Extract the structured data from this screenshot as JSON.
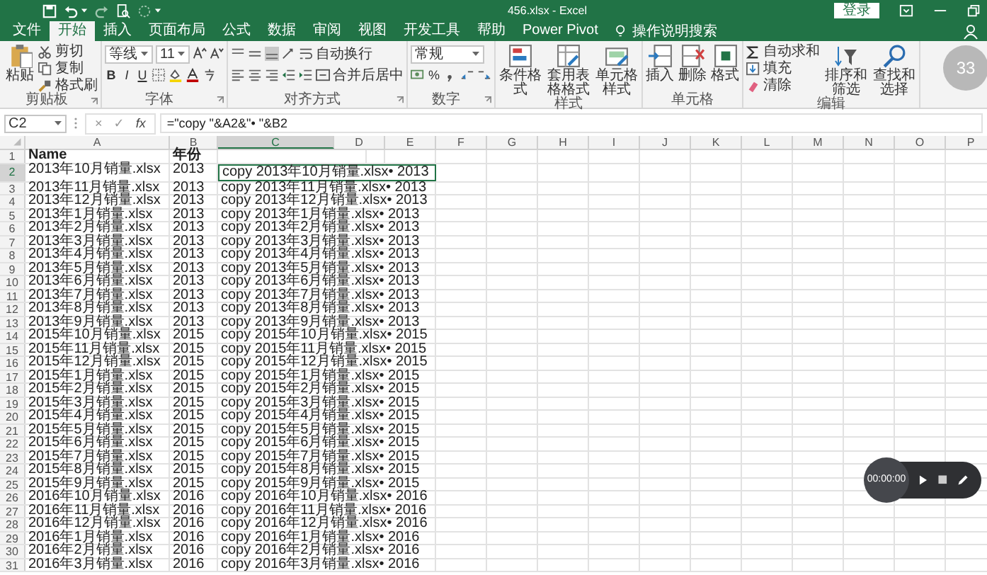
{
  "title_bar": {
    "title": "456.xlsx  -  Excel",
    "sign_in": "登录"
  },
  "tabs": [
    {
      "label": "文件",
      "selected": false
    },
    {
      "label": "开始",
      "selected": true
    },
    {
      "label": "插入",
      "selected": false
    },
    {
      "label": "页面布局",
      "selected": false
    },
    {
      "label": "公式",
      "selected": false
    },
    {
      "label": "数据",
      "selected": false
    },
    {
      "label": "审阅",
      "selected": false
    },
    {
      "label": "视图",
      "selected": false
    },
    {
      "label": "开发工具",
      "selected": false
    },
    {
      "label": "帮助",
      "selected": false
    },
    {
      "label": "Power Pivot",
      "selected": false
    }
  ],
  "tell_me": "操作说明搜索",
  "ribbon_groups": [
    {
      "kind": "clipboard",
      "label": "剪贴板",
      "buttons": [
        "粘贴",
        "剪切",
        "复制",
        "格式刷"
      ]
    },
    {
      "kind": "font",
      "label": "字体",
      "font_name": "等线",
      "font_size": "11",
      "style_buttons": [
        "B",
        "I",
        "U"
      ]
    },
    {
      "kind": "alignment",
      "label": "对齐方式",
      "buttons": [
        "自动换行",
        "合并后居中"
      ]
    },
    {
      "kind": "number",
      "label": "数字",
      "format": "常规",
      "percent": "%"
    },
    {
      "kind": "large_buttons",
      "label": "样式",
      "buttons": [
        "条件格式",
        "套用表格格式",
        "单元格样式"
      ]
    },
    {
      "kind": "large_buttons",
      "label": "单元格",
      "buttons": [
        "插入",
        "删除",
        "格式"
      ]
    },
    {
      "kind": "editing",
      "label": "编辑",
      "small_buttons": [
        "自动求和",
        "填充",
        "清除"
      ],
      "large_buttons": [
        "排序和筛选",
        "查找和选择"
      ]
    }
  ],
  "progress_badge": "33",
  "formula_bar": {
    "name_box": "C2",
    "cancel": "×",
    "enter": "✓",
    "function": "fx",
    "formula": "=\"copy \"&A2&\"• \"&B2"
  },
  "columns": [
    {
      "label": "A",
      "selected": false
    },
    {
      "label": "B",
      "selected": false
    },
    {
      "label": "C",
      "selected": true
    },
    {
      "label": "D",
      "selected": false
    },
    {
      "label": "E",
      "selected": false
    },
    {
      "label": "F",
      "selected": false
    },
    {
      "label": "G",
      "selected": false
    },
    {
      "label": "H",
      "selected": false
    },
    {
      "label": "I",
      "selected": false
    },
    {
      "label": "J",
      "selected": false
    },
    {
      "label": "K",
      "selected": false
    },
    {
      "label": "L",
      "selected": false
    },
    {
      "label": "M",
      "selected": false
    },
    {
      "label": "N",
      "selected": false
    },
    {
      "label": "O",
      "selected": false
    },
    {
      "label": "P",
      "selected": false
    }
  ],
  "rows": [
    {
      "num": "1",
      "kind": "header",
      "a": "Name",
      "b": "年份",
      "selected": false
    },
    {
      "num": "2",
      "kind": "data",
      "a": "2013年10月销量.xlsx",
      "b": "2013",
      "c": "copy 2013年10月销量.xlsx• 2013",
      "selected": true
    },
    {
      "num": "3",
      "kind": "data",
      "a": "2013年11月销量.xlsx",
      "b": "2013",
      "c": "copy 2013年11月销量.xlsx• 2013",
      "selected": false
    },
    {
      "num": "4",
      "kind": "data",
      "a": "2013年12月销量.xlsx",
      "b": "2013",
      "c": "copy 2013年12月销量.xlsx• 2013",
      "selected": false
    },
    {
      "num": "5",
      "kind": "data",
      "a": "2013年1月销量.xlsx",
      "b": "2013",
      "c": "copy 2013年1月销量.xlsx• 2013",
      "selected": false
    },
    {
      "num": "6",
      "kind": "data",
      "a": "2013年2月销量.xlsx",
      "b": "2013",
      "c": "copy 2013年2月销量.xlsx• 2013",
      "selected": false
    },
    {
      "num": "7",
      "kind": "data",
      "a": "2013年3月销量.xlsx",
      "b": "2013",
      "c": "copy 2013年3月销量.xlsx• 2013",
      "selected": false
    },
    {
      "num": "8",
      "kind": "data",
      "a": "2013年4月销量.xlsx",
      "b": "2013",
      "c": "copy 2013年4月销量.xlsx• 2013",
      "selected": false
    },
    {
      "num": "9",
      "kind": "data",
      "a": "2013年5月销量.xlsx",
      "b": "2013",
      "c": "copy 2013年5月销量.xlsx• 2013",
      "selected": false
    },
    {
      "num": "10",
      "kind": "data",
      "a": "2013年6月销量.xlsx",
      "b": "2013",
      "c": "copy 2013年6月销量.xlsx• 2013",
      "selected": false
    },
    {
      "num": "11",
      "kind": "data",
      "a": "2013年7月销量.xlsx",
      "b": "2013",
      "c": "copy 2013年7月销量.xlsx• 2013",
      "selected": false
    },
    {
      "num": "12",
      "kind": "data",
      "a": "2013年8月销量.xlsx",
      "b": "2013",
      "c": "copy 2013年8月销量.xlsx• 2013",
      "selected": false
    },
    {
      "num": "13",
      "kind": "data",
      "a": "2013年9月销量.xlsx",
      "b": "2013",
      "c": "copy 2013年9月销量.xlsx• 2013",
      "selected": false
    },
    {
      "num": "14",
      "kind": "data",
      "a": "2015年10月销量.xlsx",
      "b": "2015",
      "c": "copy 2015年10月销量.xlsx• 2015",
      "selected": false
    },
    {
      "num": "15",
      "kind": "data",
      "a": "2015年11月销量.xlsx",
      "b": "2015",
      "c": "copy 2015年11月销量.xlsx• 2015",
      "selected": false
    },
    {
      "num": "16",
      "kind": "data",
      "a": "2015年12月销量.xlsx",
      "b": "2015",
      "c": "copy 2015年12月销量.xlsx• 2015",
      "selected": false
    },
    {
      "num": "17",
      "kind": "data",
      "a": "2015年1月销量.xlsx",
      "b": "2015",
      "c": "copy 2015年1月销量.xlsx• 2015",
      "selected": false
    },
    {
      "num": "18",
      "kind": "data",
      "a": "2015年2月销量.xlsx",
      "b": "2015",
      "c": "copy 2015年2月销量.xlsx• 2015",
      "selected": false
    },
    {
      "num": "19",
      "kind": "data",
      "a": "2015年3月销量.xlsx",
      "b": "2015",
      "c": "copy 2015年3月销量.xlsx• 2015",
      "selected": false
    },
    {
      "num": "20",
      "kind": "data",
      "a": "2015年4月销量.xlsx",
      "b": "2015",
      "c": "copy 2015年4月销量.xlsx• 2015",
      "selected": false
    },
    {
      "num": "21",
      "kind": "data",
      "a": "2015年5月销量.xlsx",
      "b": "2015",
      "c": "copy 2015年5月销量.xlsx• 2015",
      "selected": false
    },
    {
      "num": "22",
      "kind": "data",
      "a": "2015年6月销量.xlsx",
      "b": "2015",
      "c": "copy 2015年6月销量.xlsx• 2015",
      "selected": false
    },
    {
      "num": "23",
      "kind": "data",
      "a": "2015年7月销量.xlsx",
      "b": "2015",
      "c": "copy 2015年7月销量.xlsx• 2015",
      "selected": false
    },
    {
      "num": "24",
      "kind": "data",
      "a": "2015年8月销量.xlsx",
      "b": "2015",
      "c": "copy 2015年8月销量.xlsx• 2015",
      "selected": false
    },
    {
      "num": "25",
      "kind": "data",
      "a": "2015年9月销量.xlsx",
      "b": "2015",
      "c": "copy 2015年9月销量.xlsx• 2015",
      "selected": false
    },
    {
      "num": "26",
      "kind": "data",
      "a": "2016年10月销量.xlsx",
      "b": "2016",
      "c": "copy 2016年10月销量.xlsx• 2016",
      "selected": false
    },
    {
      "num": "27",
      "kind": "data",
      "a": "2016年11月销量.xlsx",
      "b": "2016",
      "c": "copy 2016年11月销量.xlsx• 2016",
      "selected": false
    },
    {
      "num": "28",
      "kind": "data",
      "a": "2016年12月销量.xlsx",
      "b": "2016",
      "c": "copy 2016年12月销量.xlsx• 2016",
      "selected": false
    },
    {
      "num": "29",
      "kind": "data",
      "a": "2016年1月销量.xlsx",
      "b": "2016",
      "c": "copy 2016年1月销量.xlsx• 2016",
      "selected": false
    },
    {
      "num": "30",
      "kind": "data",
      "a": "2016年2月销量.xlsx",
      "b": "2016",
      "c": "copy 2016年2月销量.xlsx• 2016",
      "selected": false
    },
    {
      "num": "31",
      "kind": "data",
      "a": "2016年3月销量.xlsx",
      "b": "2016",
      "c": "copy 2016年3月销量.xlsx• 2016",
      "selected": false
    }
  ],
  "recorder": {
    "time": "00:00:00"
  }
}
